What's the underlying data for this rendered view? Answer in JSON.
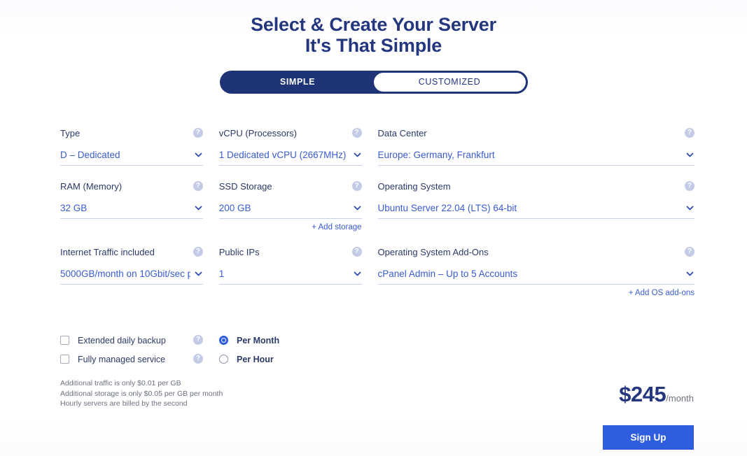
{
  "heading": {
    "line1": "Select & Create Your Server",
    "line2": "It's That Simple"
  },
  "toggle": {
    "simple_label": "SIMPLE",
    "customized_label": "CUSTOMIZED",
    "selected": "SIMPLE",
    "active_bg": "#1f3476",
    "inactive_text": "#24377e"
  },
  "help_icon_glyph": "?",
  "fields": {
    "type": {
      "label": "Type",
      "value": "D – Dedicated",
      "help": "?"
    },
    "vcpu": {
      "label": "vCPU (Processors)",
      "value": "1 Dedicated vCPU (2667MHz)",
      "help": "?"
    },
    "data_center": {
      "label": "Data Center",
      "value": "Europe: Germany, Frankfurt",
      "help": "?"
    },
    "ram": {
      "label": "RAM (Memory)",
      "value": "32 GB",
      "help": "?"
    },
    "ssd": {
      "label": "SSD Storage",
      "value": "200 GB",
      "help": "?",
      "add_link": "+ Add storage"
    },
    "os": {
      "label": "Operating System",
      "value": "Ubuntu Server 22.04 (LTS) 64-bit",
      "help": "?"
    },
    "traffic": {
      "label": "Internet Traffic included",
      "value": "5000GB/month on 10Gbit/sec p",
      "help": "?"
    },
    "public_ips": {
      "label": "Public IPs",
      "value": "1",
      "help": "?"
    },
    "os_addons": {
      "label": "Operating System Add-Ons",
      "value": "cPanel Admin – Up to 5 Accounts",
      "help": "?",
      "add_link": "+ Add OS add-ons"
    }
  },
  "options": [
    {
      "label": "Extended daily backup",
      "checked": false,
      "help": "?"
    },
    {
      "label": "Fully managed service",
      "checked": false,
      "help": "?"
    }
  ],
  "billing": [
    {
      "label": "Per Month",
      "selected": true
    },
    {
      "label": "Per Hour",
      "selected": false
    }
  ],
  "fineprint": [
    "Additional traffic is only $0.01 per GB",
    "Additional storage is only $0.05 per GB per month",
    "Hourly servers are billed by the second"
  ],
  "price": {
    "amount": "$245",
    "period": "/month"
  },
  "cta": {
    "label": "Sign Up",
    "color": "#2f5de0"
  }
}
